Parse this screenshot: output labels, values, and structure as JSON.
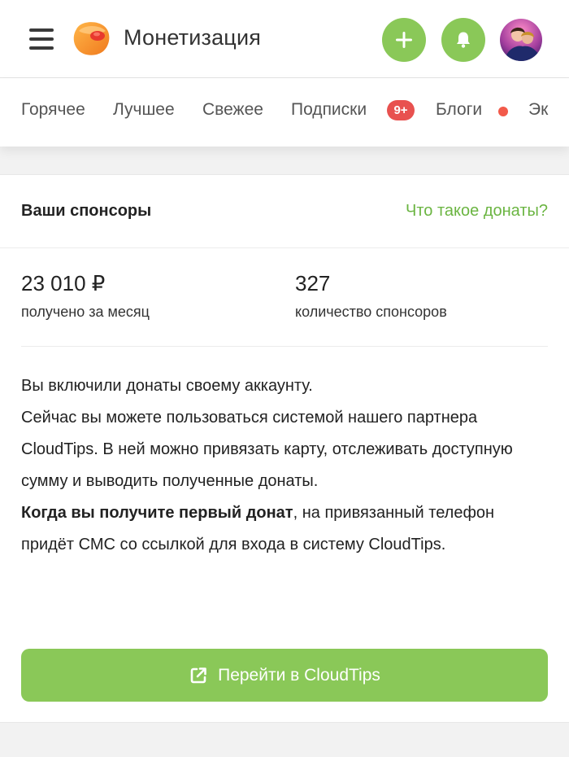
{
  "header": {
    "title": "Монетизация",
    "menu_icon": "hamburger-menu-icon",
    "logo_icon": "pikabu-logo-icon",
    "add_icon": "plus-icon",
    "notifications_icon": "bell-icon",
    "avatar": "user-avatar"
  },
  "tabs": [
    {
      "label": "Горячее"
    },
    {
      "label": "Лучшее"
    },
    {
      "label": "Свежее"
    },
    {
      "label": "Подписки",
      "badge": "9+"
    },
    {
      "label": "Блоги",
      "indicator": "unread-dot"
    },
    {
      "label": "Эк"
    }
  ],
  "sponsors_card": {
    "title": "Ваши спонсоры",
    "help_link": "Что такое донаты?",
    "stats": [
      {
        "value": "23 010 ₽",
        "label": "получено за месяц"
      },
      {
        "value": "327",
        "label": "количество спонсоров"
      }
    ],
    "description": {
      "line1": "Вы включили донаты своему аккаунту.",
      "line2": "Сейчас вы можете пользоваться системой нашего партнера CloudTips. В ней можно привязать карту, отслеживать доступную сумму и выводить полученные донаты.",
      "bold_lead": "Когда вы получите первый донат",
      "line3": ", на привязанный телефон придёт СМС со ссылкой для входа в систему CloudTips."
    },
    "cta_label": "Перейти в CloudTips",
    "cta_icon": "external-link-icon"
  },
  "colors": {
    "accent_green": "#8ac858",
    "link_green": "#6bb542",
    "badge_red": "#e8514f",
    "text_dark": "#222222"
  }
}
